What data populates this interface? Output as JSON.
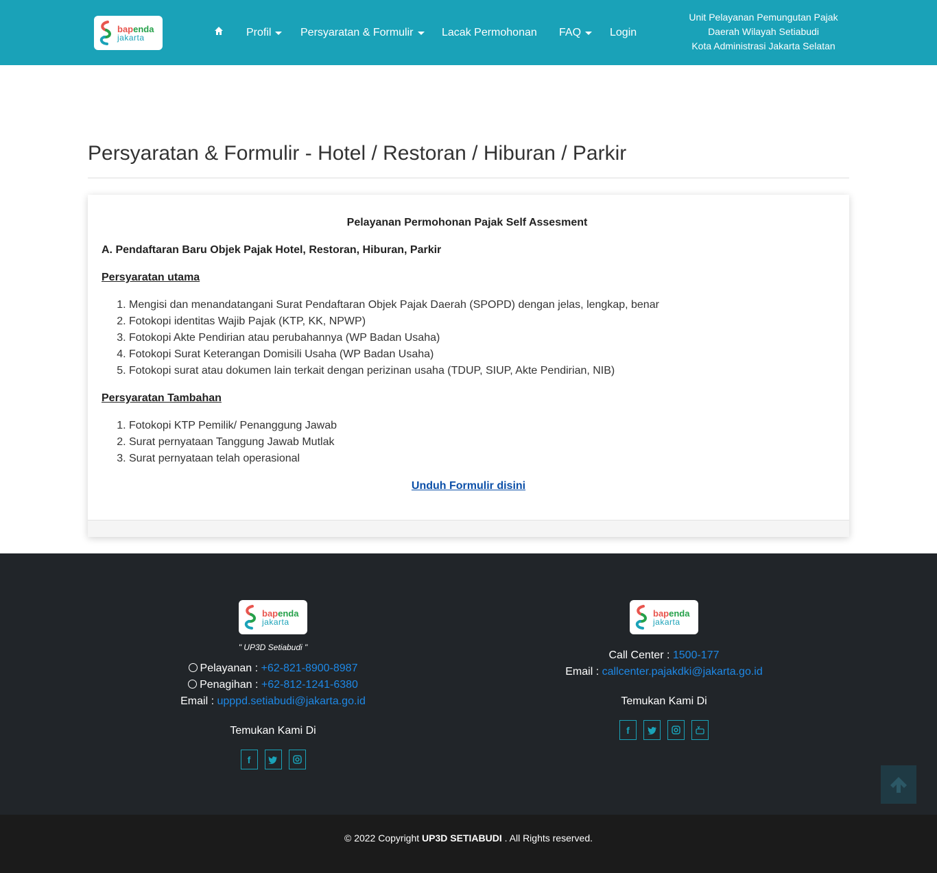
{
  "header": {
    "logo": {
      "line1a": "bap",
      "line1b": "enda",
      "line2": "jakarta"
    },
    "nav": {
      "home_icon": "home-icon",
      "profil": "Profil",
      "persyaratan": "Persyaratan & Formulir",
      "lacak": "Lacak Permohonan",
      "faq": "FAQ",
      "login": "Login"
    },
    "unit": {
      "line1": "Unit Pelayanan Pemungutan Pajak",
      "line2": "Daerah Wilayah Setiabudi",
      "line3": "Kota Administrasi Jakarta Selatan"
    }
  },
  "main": {
    "title": "Persyaratan & Formulir - Hotel / Restoran / Hiburan / Parkir",
    "card": {
      "heading": "Pelayanan Permohonan Pajak Self Assesment",
      "section_a": "A. Pendaftaran Baru Objek Pajak Hotel, Restoran, Hiburan, Parkir",
      "primary_title": "Persyaratan utama",
      "primary_items": [
        "Mengisi dan menandatangani Surat Pendaftaran Objek Pajak Daerah (SPOPD) dengan jelas, lengkap, benar",
        "Fotokopi identitas Wajib Pajak (KTP, KK, NPWP)",
        "Fotokopi Akte Pendirian atau perubahannya (WP Badan Usaha)",
        "Fotokopi Surat Keterangan Domisili Usaha (WP Badan Usaha)",
        "Fotokopi surat atau dokumen lain terkait dengan perizinan usaha (TDUP, SIUP, Akte Pendirian, NIB)"
      ],
      "additional_title": "Persyaratan Tambahan",
      "additional_items": [
        "Fotokopi KTP Pemilik/ Penanggung Jawab",
        "Surat pernyataan Tanggung Jawab Mutlak",
        "Surat pernyataan telah operasional"
      ],
      "download": "Unduh Formulir disini"
    }
  },
  "footer": {
    "left": {
      "tagline": "\" UP3D Setiabudi \"",
      "pelayanan_label": "Pelayanan : ",
      "pelayanan_value": "+62-821-8900-8987",
      "penagihan_label": "Penagihan : ",
      "penagihan_value": "+62-812-1241-6380",
      "email_label": "Email : ",
      "email_value": "upppd.setiabudi@jakarta.go.id",
      "find": "Temukan Kami Di",
      "socials": [
        "facebook-icon",
        "twitter-icon",
        "instagram-icon"
      ]
    },
    "right": {
      "callcenter_label": "Call Center : ",
      "callcenter_value": "1500-177",
      "email_label": "Email : ",
      "email_value": "callcenter.pajakdki@jakarta.go.id",
      "find": "Temukan Kami Di",
      "socials": [
        "facebook-icon",
        "twitter-icon",
        "instagram-icon",
        "youtube-icon"
      ]
    },
    "copyright_pre": "© 2022 Copyright ",
    "copyright_name": "UP3D SETIABUDI",
    "copyright_post": " . All Rights reserved."
  },
  "colors": {
    "header": "#1aa2b8",
    "footer": "#212529",
    "link": "#1e88e5",
    "download_link": "#0b4fa8"
  }
}
